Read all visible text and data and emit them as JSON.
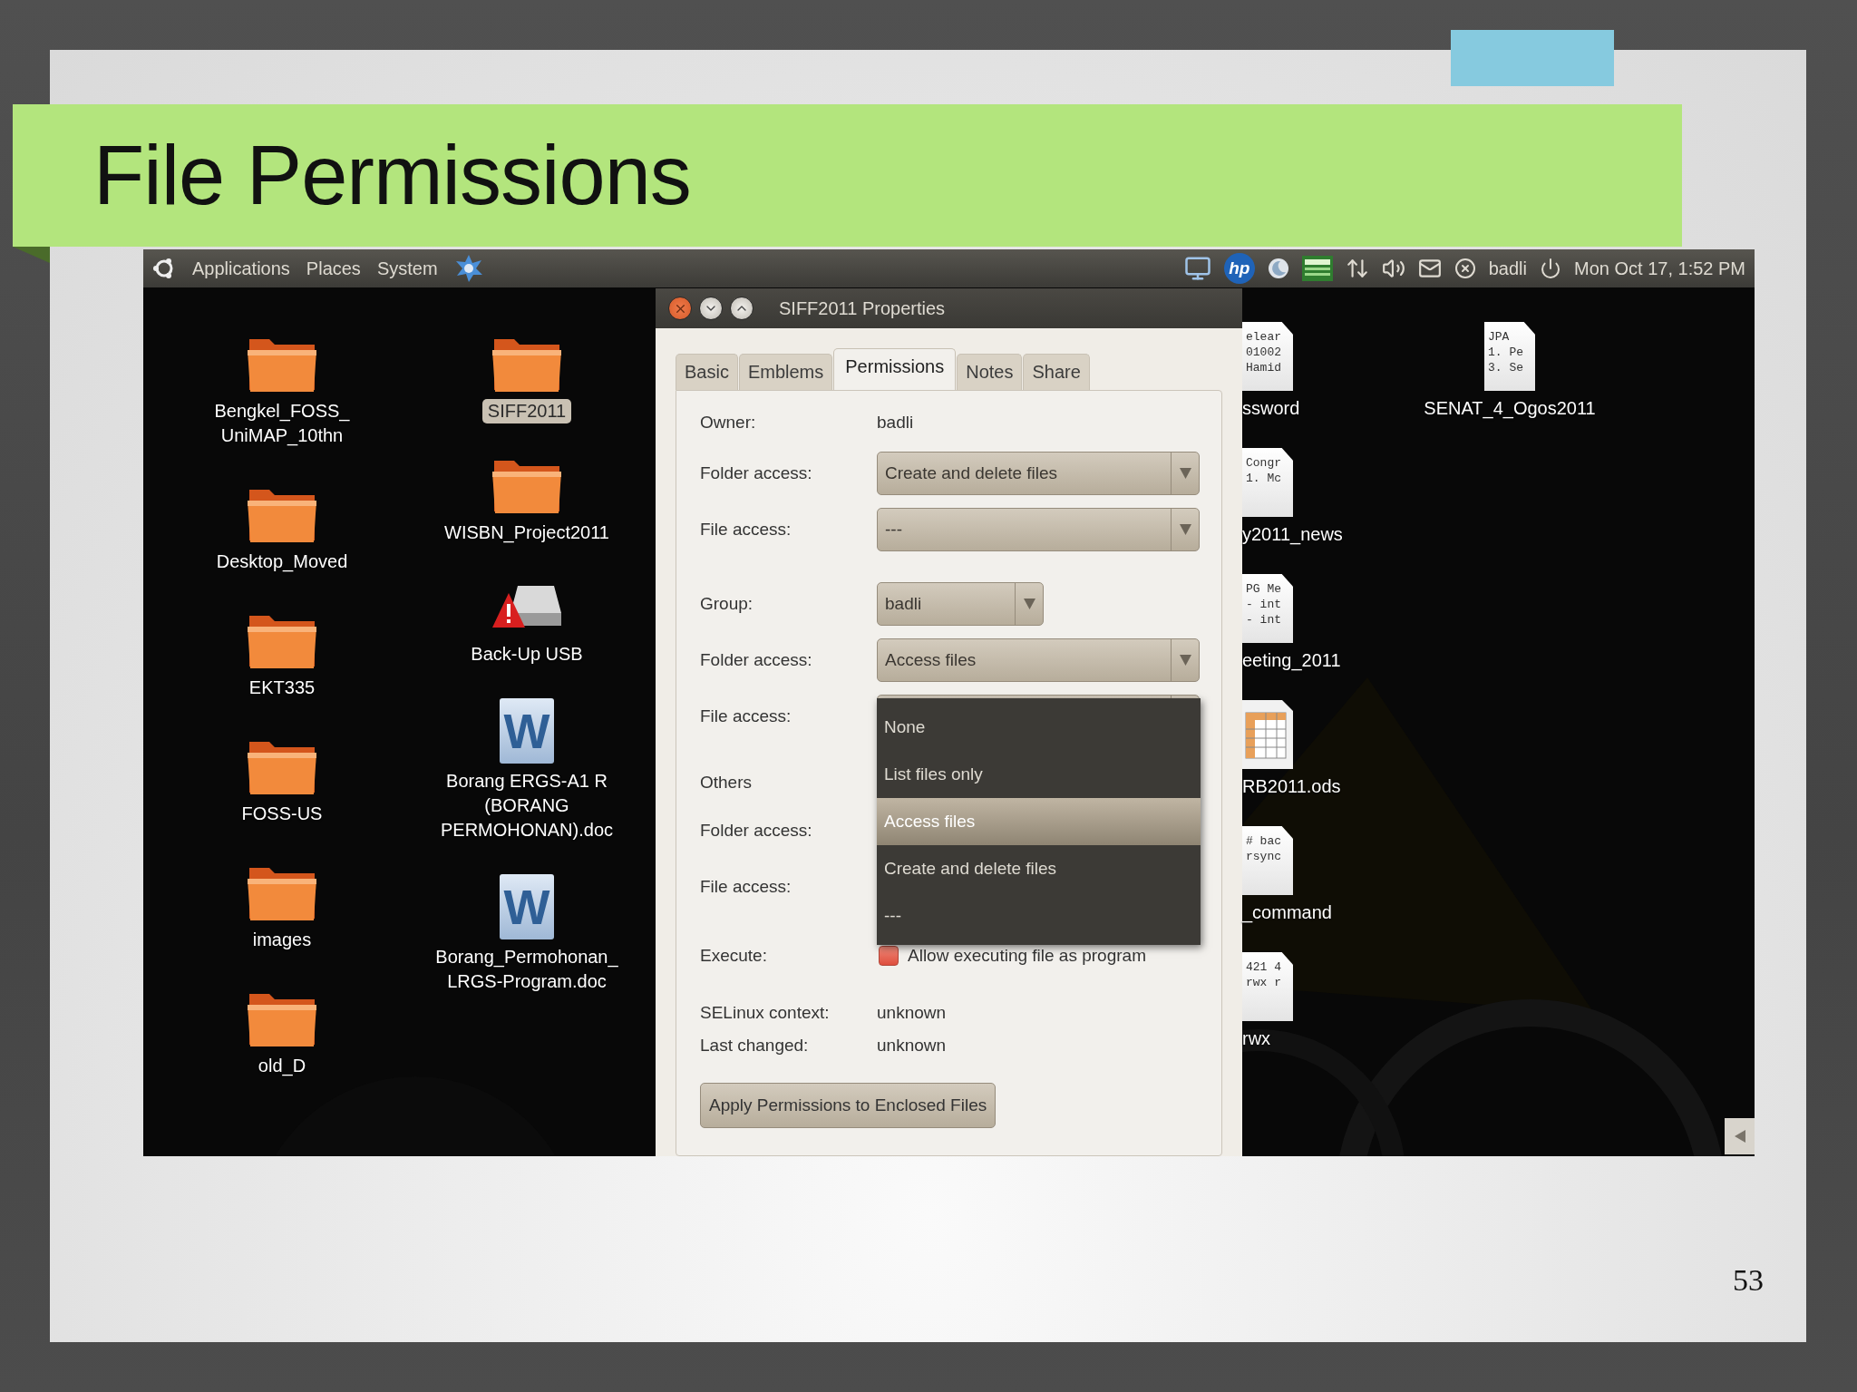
{
  "slide": {
    "title": "File Permissions",
    "page_number": "53"
  },
  "panel": {
    "menus": [
      "Applications",
      "Places",
      "System"
    ],
    "logo_text": "hp",
    "user": "badli",
    "clock": "Mon Oct 17,  1:52 PM"
  },
  "desktop": {
    "columns": [
      [
        {
          "kind": "folder",
          "label": "Bengkel_FOSS_\nUniMAP_10thn",
          "selected": false
        },
        {
          "kind": "folder",
          "label": "Desktop_Moved",
          "selected": false
        },
        {
          "kind": "folder",
          "label": "EKT335",
          "selected": false
        },
        {
          "kind": "folder",
          "label": "FOSS-US",
          "selected": false
        },
        {
          "kind": "folder",
          "label": "images",
          "selected": false
        },
        {
          "kind": "folder",
          "label": "old_D",
          "selected": false
        }
      ],
      [
        {
          "kind": "folder",
          "label": "SIFF2011",
          "selected": true
        },
        {
          "kind": "folder",
          "label": "WISBN_Project2011",
          "selected": false
        },
        {
          "kind": "drive",
          "label": "Back-Up USB",
          "selected": false
        },
        {
          "kind": "word",
          "badge": "W",
          "label": "Borang ERGS-A1 R\n(BORANG\nPERMOHONAN).doc",
          "selected": false
        },
        {
          "kind": "word",
          "badge": "W",
          "label": "Borang_Permohonan_\nLRGS-Program.doc",
          "selected": false
        }
      ]
    ],
    "right_icons": [
      {
        "kind": "text",
        "preview": [
          "elear",
          "01002",
          "Hamid"
        ],
        "label": "ssword"
      },
      {
        "kind": "text",
        "preview": [
          "Congr",
          "1. Mc"
        ],
        "label": "y2011_news"
      },
      {
        "kind": "text",
        "preview": [
          "PG Me",
          "- int",
          "- int"
        ],
        "label": "eeting_2011"
      },
      {
        "kind": "sheet",
        "label": "RB2011.ods"
      },
      {
        "kind": "text",
        "preview": [
          "# bac",
          "rsync"
        ],
        "label": "_command"
      },
      {
        "kind": "text",
        "preview": [
          "421 4",
          "rwx r"
        ],
        "label": "rwx"
      }
    ],
    "far_icon": {
      "kind": "text",
      "preview": [
        "JPA",
        "1. Pe",
        "3. Se"
      ],
      "label": "SENAT_4_Ogos2011"
    }
  },
  "dialog": {
    "title": "SIFF2011 Properties",
    "tabs": [
      {
        "label": "Basic",
        "selected": false
      },
      {
        "label": "Emblems",
        "selected": false
      },
      {
        "label": "Permissions",
        "selected": true
      },
      {
        "label": "Notes",
        "selected": false
      },
      {
        "label": "Share",
        "selected": false
      }
    ],
    "sections": [
      [
        {
          "kind": "value",
          "label": "Owner:",
          "value": "badli"
        },
        {
          "kind": "combo",
          "label": "Folder access:",
          "value": "Create and delete files",
          "wide": true
        },
        {
          "kind": "combo",
          "label": "File access:",
          "value": "---",
          "wide": true
        }
      ],
      [
        {
          "kind": "combo",
          "label": "Group:",
          "value": "badli",
          "wide": false
        },
        {
          "kind": "combo",
          "label": "Folder access:",
          "value": "Access files",
          "wide": true
        },
        {
          "kind": "combo",
          "label": "File access:",
          "wide": true,
          "menu": [
            {
              "label": "None",
              "selected": false
            },
            {
              "label": "List files only",
              "selected": false
            },
            {
              "label": "Access files",
              "selected": true
            },
            {
              "label": "Create and delete files",
              "selected": false
            },
            {
              "label": "---",
              "selected": false
            }
          ]
        }
      ],
      [
        {
          "kind": "heading",
          "label": "Others"
        },
        {
          "kind": "label",
          "label": "Folder access:"
        },
        {
          "kind": "label",
          "label": "File access:"
        }
      ],
      [
        {
          "kind": "checkbox",
          "label": "Execute:",
          "text": "Allow executing file as program",
          "checked": false
        }
      ],
      [
        {
          "kind": "info",
          "label": "SELinux context:",
          "value": "unknown"
        },
        {
          "kind": "info",
          "label": "Last changed:",
          "value": "unknown"
        }
      ]
    ],
    "button": "Apply Permissions to Enclosed Files"
  }
}
